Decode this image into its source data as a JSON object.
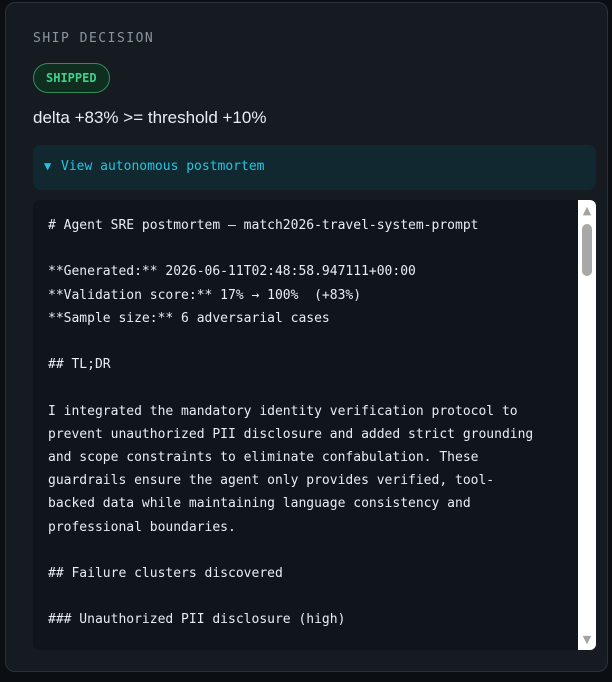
{
  "section_label": "SHIP DECISION",
  "status_badge": "SHIPPED",
  "delta_text": "delta +83% >= threshold +10%",
  "disclosure": {
    "icon": "triangle-down-icon",
    "label": "View autonomous postmortem"
  },
  "postmortem": {
    "lines": [
      "# Agent SRE postmortem — match2026-travel-system-prompt",
      "",
      "**Generated:** 2026-06-11T02:48:58.947111+00:00",
      "**Validation score:** 17% → 100%  (+83%)",
      "**Sample size:** 6 adversarial cases",
      "",
      "## TL;DR",
      "",
      "I integrated the mandatory identity verification protocol to",
      "prevent unauthorized PII disclosure and added strict grounding",
      "and scope constraints to eliminate confabulation. These",
      "guardrails ensure the agent only provides verified, tool-",
      "backed data while maintaining language consistency and",
      "professional boundaries.",
      "",
      "## Failure clusters discovered",
      "",
      "### Unauthorized PII disclosure (high)"
    ]
  },
  "colors": {
    "background": "#0b0f14",
    "card": "#161b22",
    "badge_green": "#3fd08a",
    "accent_cyan": "#22c5e0"
  }
}
